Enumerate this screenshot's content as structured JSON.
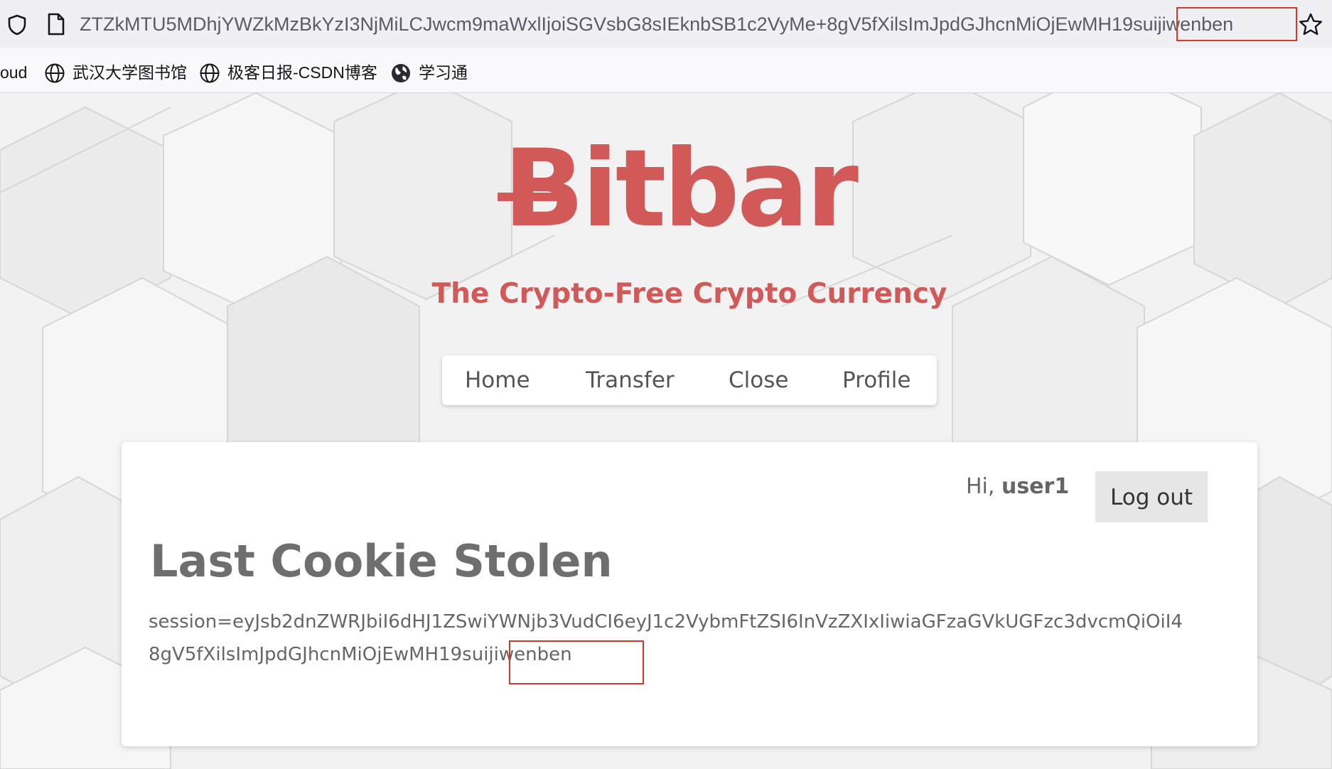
{
  "browser": {
    "url": "ZTZkMTU5MDhjYWZkMzBkYzI3NjMiLCJwcm9maWxlIjoiSGVsbG8sIEknbSB1c2VyMe+8gV5fXilsImJpdGJhcnMiOjEwMH19suijiwenben",
    "bookmarks": [
      {
        "label": "oud",
        "icon": "none"
      },
      {
        "label": "武汉大学图书馆",
        "icon": "globe-icon"
      },
      {
        "label": "极客日报-CSDN博客",
        "icon": "globe-icon"
      },
      {
        "label": "学习通",
        "icon": "world-icon"
      }
    ]
  },
  "site": {
    "logo": "Bitbar",
    "tagline": "The Crypto-Free Crypto Currency",
    "brand_color": "#d15a58"
  },
  "nav": {
    "home": "Home",
    "transfer": "Transfer",
    "close": "Close",
    "profile": "Profile"
  },
  "user": {
    "greeting_prefix": "Hi, ",
    "username": "user1",
    "logout_label": "Log out"
  },
  "main": {
    "heading": "Last Cookie Stolen",
    "cookie_line1": "session=eyJsb2dnZWRJbiI6dHJ1ZSwiYWNjb3VudCI6eyJ1c2VybmFtZSI6InVzZXIxIiwiaGFzaGVkUGFzc3dvcmQiOiI4",
    "cookie_line2": "8gV5fXilsImJpdGJhcnMiOjEwMH19suijiwenben"
  }
}
